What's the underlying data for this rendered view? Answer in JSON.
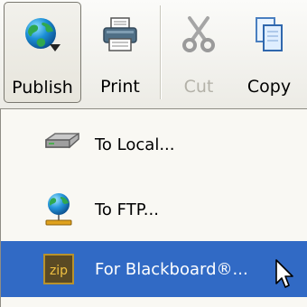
{
  "toolbar": {
    "buttons": [
      {
        "label": "Publish",
        "icon": "globe-publish-icon",
        "state": "pressed"
      },
      {
        "label": "Print",
        "icon": "printer-icon",
        "state": "enabled"
      },
      {
        "label": "Cut",
        "icon": "scissors-icon",
        "state": "disabled"
      },
      {
        "label": "Copy",
        "icon": "copy-icon",
        "state": "enabled"
      }
    ]
  },
  "publish_menu": {
    "items": [
      {
        "label": "To Local...",
        "icon": "disk-drive-icon"
      },
      {
        "label": "To FTP...",
        "icon": "network-globe-icon"
      },
      {
        "label": "For Blackboard®...",
        "icon": "zip-archive-icon",
        "icon_text": "zip",
        "highlighted": true
      }
    ]
  },
  "colors": {
    "highlight": "#316ac5",
    "toolbar_bg": "#ecebe5",
    "menu_bg": "#f9f8f3",
    "disabled_text": "#b3b1a8"
  },
  "pointer": "arrow-cursor-icon"
}
